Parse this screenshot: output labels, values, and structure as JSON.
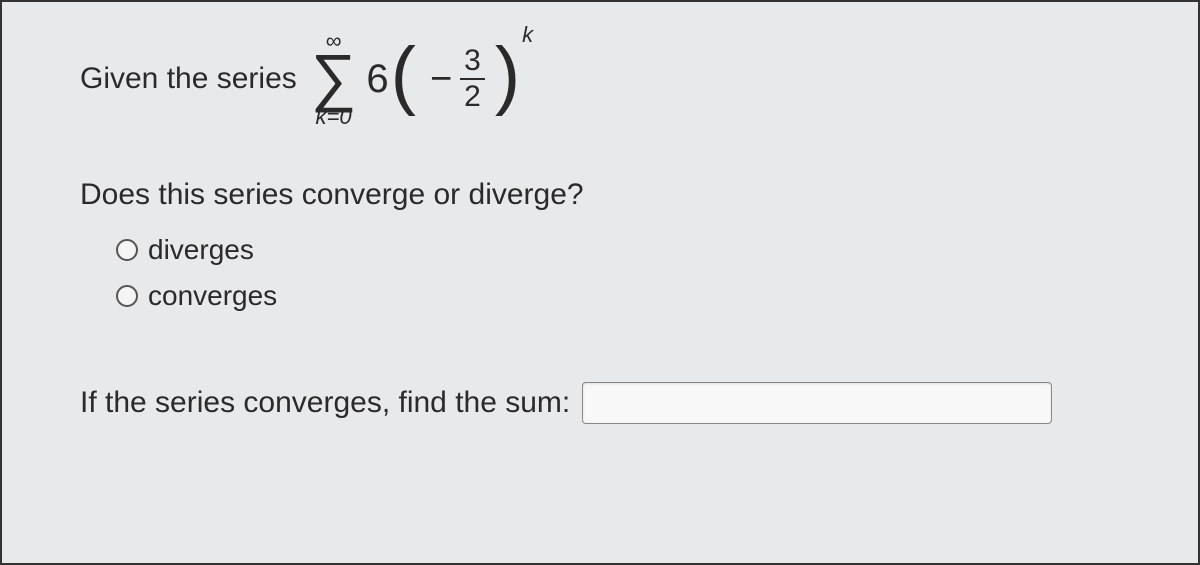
{
  "series": {
    "intro": "Given the series",
    "sigma_upper": "∞",
    "sigma_lower_var": "k",
    "sigma_lower_eq": "=",
    "sigma_lower_val": "0",
    "coefficient": "6",
    "sign": "−",
    "numerator": "3",
    "denominator": "2",
    "exponent": "k"
  },
  "question": "Does this series converge or diverge?",
  "options": {
    "diverges": "diverges",
    "converges": "converges"
  },
  "sum_prompt": "If the series converges, find the sum:",
  "sum_value": ""
}
